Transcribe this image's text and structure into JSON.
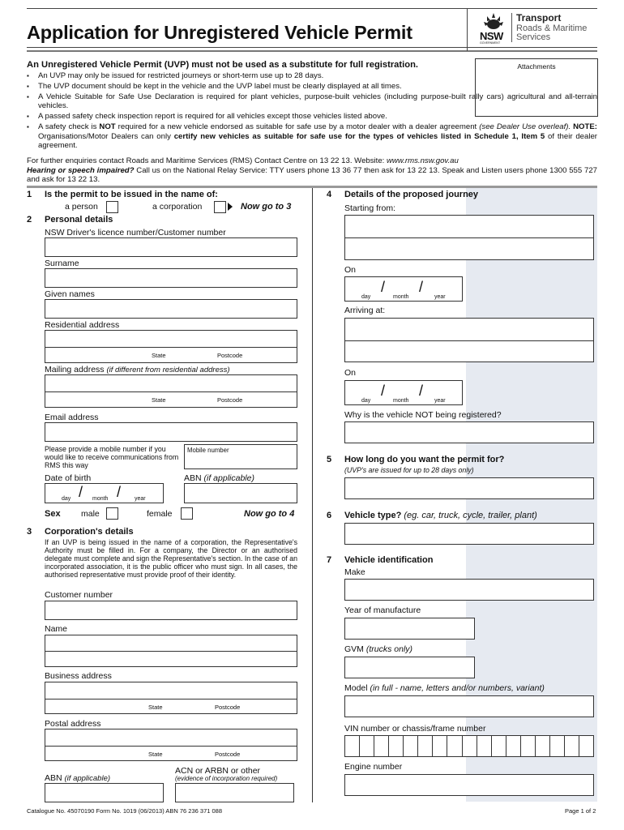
{
  "header": {
    "title": "Application for Unregistered Vehicle Permit",
    "logo": {
      "nsw": "NSW",
      "gov": "GOVERNMENT",
      "line1": "Transport",
      "line2": "Roads & Maritime",
      "line3": "Services"
    },
    "attachments_label": "Attachments"
  },
  "intro": {
    "heading": "An Unregistered Vehicle Permit (UVP) must not be used as a substitute for full registration.",
    "bullets": [
      "An UVP may only be issued for restricted journeys or short-term use up to 28 days.",
      "The UVP document should be kept in the vehicle and the UVP label must be clearly displayed at all times.",
      "A Vehicle Suitable for Safe Use Declaration is required for plant vehicles, purpose-built vehicles (including purpose-built rally cars) agricultural  and all-terrain vehicles.",
      "A passed safety check inspection report is required for all vehicles except those vehicles listed above."
    ],
    "bullet5": {
      "a": "A safety check is ",
      "b": "NOT",
      "c": " required for a new vehicle endorsed as suitable for safe use by a motor dealer with a dealer agreement ",
      "d": "(see Dealer Use overleaf).",
      "e": " NOTE:",
      "f": " Organisations/Motor Dealers can only ",
      "g": "certify new vehicles as suitable for safe use for the types of vehicles listed in Schedule 1, Item 5",
      "h": " of their dealer agreement."
    },
    "enquiry": "For further enquiries contact Roads and Maritime Services (RMS) Contact Centre on 13 22 13.  Website: ",
    "website": "www.rms.nsw.gov.au",
    "hearing_label": "Hearing or speech impaired?",
    "hearing_text": " Call us on the National Relay Service: TTY users phone 13 36 77 then ask for 13 22 13. Speak and Listen users phone 1300 555 727 and ask for 13 22 13."
  },
  "q1": {
    "num": "1",
    "question": "Is the permit to be issued in the name of:",
    "person": "a person",
    "corporation": "a corporation",
    "goto": "Now go to 3"
  },
  "q2": {
    "num": "2",
    "heading": "Personal details",
    "licence": "NSW Driver's licence number/Customer number",
    "surname": "Surname",
    "given": "Given names",
    "residential": "Residential address",
    "state": "State",
    "postcode": "Postcode",
    "mailing": "Mailing address ",
    "mailing_note": "(if different from residential address)",
    "email": "Email address",
    "mobile_note": "Please provide a mobile number if you would like to receive communications from RMS this way",
    "mobile": "Mobile number",
    "dob": "Date of birth",
    "abn": "ABN ",
    "abn_note": "(if applicable)",
    "day": "day",
    "month": "month",
    "year": "year",
    "slash": "/",
    "sex": "Sex",
    "male": "male",
    "female": "female",
    "goto": "Now go to 4"
  },
  "q3": {
    "num": "3",
    "heading": "Corporation's details",
    "para": "If an UVP is being issued in the name of a corporation, the Representative's Authority must be filled in. For a company, the Director or an authorised delegate must complete and sign the Representative's section.  In the case of an incorporated association, it is the public officer who must sign. In all cases, the authorised representative must provide proof of their identity.",
    "customer": "Customer number",
    "name": "Name",
    "business": "Business address",
    "postal": "Postal  address",
    "abn": "ABN ",
    "abn_note": "(if applicable)",
    "acn": "ACN or ARBN or other",
    "acn_note": "(evidence of incorporation required)"
  },
  "q4": {
    "num": "4",
    "heading": "Details of the proposed journey",
    "starting": "Starting from:",
    "on": "On",
    "arriving": "Arriving at:",
    "why": "Why is the vehicle NOT being registered?"
  },
  "q5": {
    "num": "5",
    "heading": "How long do you want the permit for?",
    "note": "(UVP's are issued for up to 28 days only)"
  },
  "q6": {
    "num": "6",
    "heading": "Vehicle type?",
    "note": " (eg. car, truck, cycle, trailer, plant)"
  },
  "q7": {
    "num": "7",
    "heading": "Vehicle identification",
    "make": "Make",
    "year": "Year of manufacture",
    "gvm": "GVM ",
    "gvm_note": "(trucks only)",
    "model": "Model ",
    "model_note": "(in full - name, letters and/or numbers, variant)",
    "vin": "VIN number or chassis/frame number",
    "vin_boxes": 17,
    "engine": "Engine number"
  },
  "footer": {
    "catalogue": "Catalogue No. 45070190  Form No. 1019 (06/2013)  ABN 76 236 371 088",
    "page": "Page 1 of 2"
  }
}
